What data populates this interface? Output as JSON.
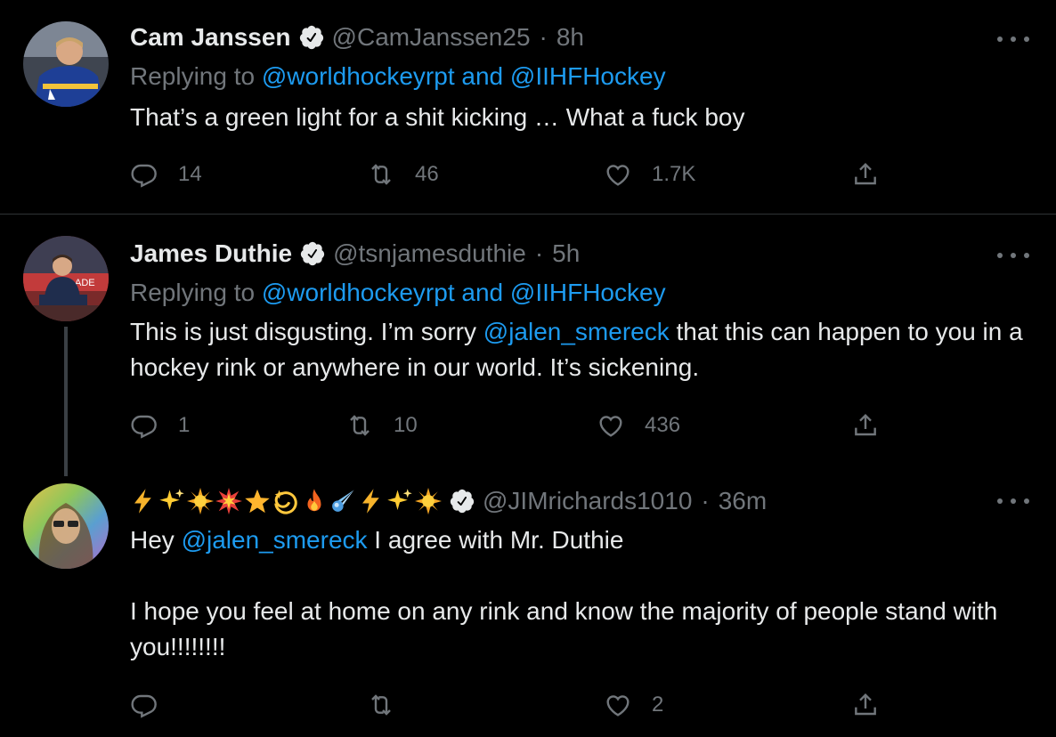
{
  "tweets": [
    {
      "name": "Cam Janssen",
      "handle": "@CamJanssen25",
      "time": "8h",
      "replying_prefix": "Replying to",
      "replying_to_1": "@worldhockeyrpt",
      "replying_and": "and",
      "replying_to_2": "@IIHFHockey",
      "text": "That’s a green light for a shit kicking … What a fuck boy",
      "replies": "14",
      "retweets": "46",
      "likes": "1.7K"
    },
    {
      "name": "James Duthie",
      "handle": "@tsnjamesduthie",
      "time": "5h",
      "replying_prefix": "Replying to",
      "replying_to_1": "@worldhockeyrpt",
      "replying_and": "and",
      "replying_to_2": "@IIHFHockey",
      "text_1": "This is just disgusting. I’m sorry ",
      "text_mention": "@jalen_smereck",
      "text_2": " that this can happen to you in a hockey rink or anywhere in our world.  It’s sickening.",
      "replies": "1",
      "retweets": "10",
      "likes": "436"
    },
    {
      "name_emojis": [
        "lightning",
        "sparkles",
        "sun",
        "collision",
        "star",
        "dizzy",
        "fire",
        "comet",
        "lightning",
        "sparkles",
        "sun"
      ],
      "handle": "@JIMrichards1010",
      "time": "36m",
      "text_1": "Hey ",
      "text_mention": "@jalen_smereck",
      "text_2": " I agree with Mr. Duthie",
      "text_3": "I hope you feel at home on any rink and know the majority of people stand with you!!!!!!!!",
      "replies": "",
      "retweets": "",
      "likes": "2"
    }
  ],
  "sep": "·",
  "icons": {
    "verified": "verified-badge-icon",
    "more": "more-icon",
    "reply": "reply-icon",
    "retweet": "retweet-icon",
    "like": "like-icon",
    "share": "share-icon"
  },
  "colors": {
    "background": "#000000",
    "text": "#e7e9ea",
    "muted": "#71767b",
    "link": "#1d9bf0",
    "divider": "#2f3336"
  }
}
